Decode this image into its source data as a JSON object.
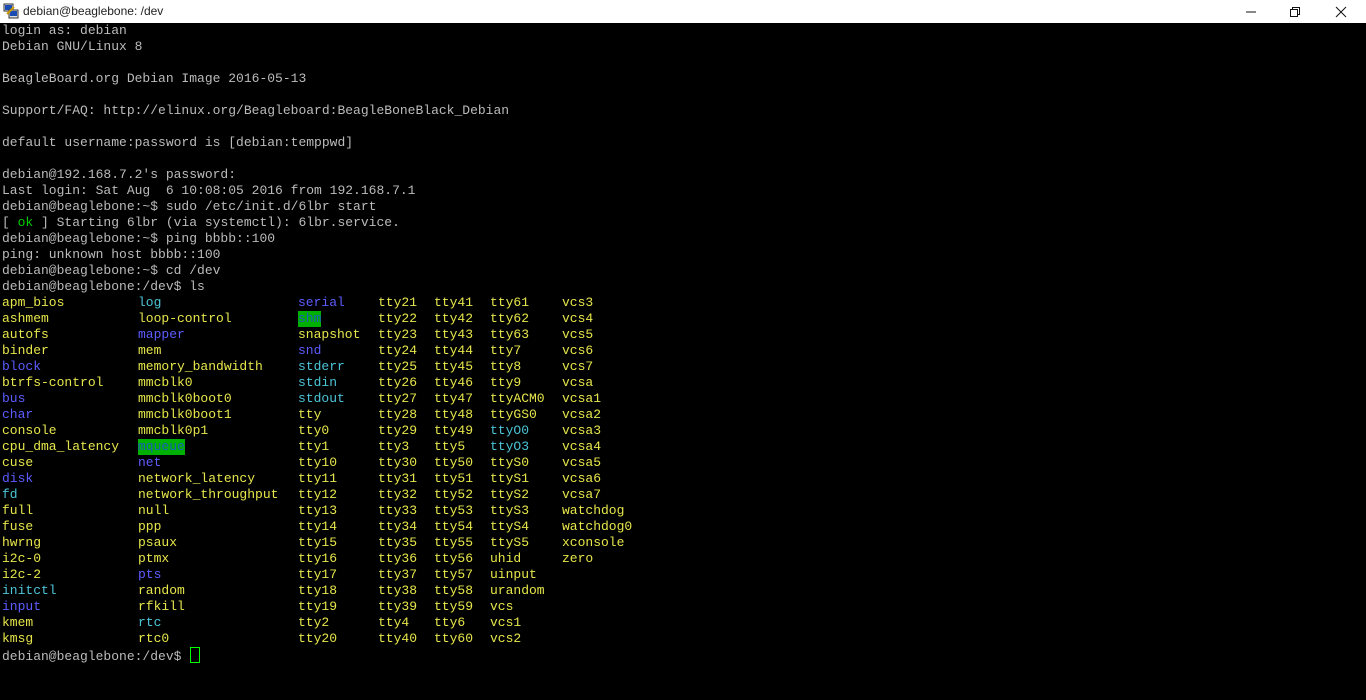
{
  "window": {
    "title": "debian@beaglebone: /dev",
    "app_icon": "putty-icon",
    "controls": [
      "minimize-icon",
      "maximize-icon",
      "close-icon"
    ]
  },
  "colors": {
    "background": "#000000",
    "text": "#bbbbbb",
    "file": "#e6e64c",
    "directory": "#5c5cff",
    "link": "#4cc4d8",
    "ok": "#00cd00",
    "highlight_bg": "#00b000"
  },
  "terminal": {
    "lines": [
      [
        {
          "t": "login as: debian"
        }
      ],
      [
        {
          "t": "Debian GNU/Linux 8"
        }
      ],
      [],
      [
        {
          "t": "BeagleBoard.org Debian Image 2016-05-13"
        }
      ],
      [],
      [
        {
          "t": "Support/FAQ: http://elinux.org/Beagleboard:BeagleBoneBlack_Debian"
        }
      ],
      [],
      [
        {
          "t": "default username:password is [debian:temppwd]"
        }
      ],
      [],
      [
        {
          "t": "debian@192.168.7.2's password:"
        }
      ],
      [
        {
          "t": "Last login: Sat Aug  6 10:08:05 2016 from 192.168.7.1"
        }
      ],
      [
        {
          "t": "debian@beaglebone:~$ sudo /etc/init.d/6lbr start"
        }
      ],
      [
        {
          "t": "[ "
        },
        {
          "t": "ok",
          "c": "green"
        },
        {
          "t": " ] Starting 6lbr (via systemctl): 6lbr.service."
        }
      ],
      [
        {
          "t": "debian@beaglebone:~$ ping bbbb::100"
        }
      ],
      [
        {
          "t": "ping: unknown host bbbb::100"
        }
      ],
      [
        {
          "t": "debian@beaglebone:~$ cd /dev"
        }
      ],
      [
        {
          "t": "debian@beaglebone:/dev$ ls"
        }
      ]
    ],
    "ls_grid": [
      [
        {
          "t": "apm_bios",
          "c": "yellow"
        },
        {
          "t": "log",
          "c": "cyan"
        },
        {
          "t": "serial",
          "c": "blue"
        },
        {
          "t": "tty21",
          "c": "yellow"
        },
        {
          "t": "tty41",
          "c": "yellow"
        },
        {
          "t": "tty61",
          "c": "yellow"
        },
        {
          "t": "vcs3",
          "c": "yellow"
        }
      ],
      [
        {
          "t": "ashmem",
          "c": "yellow"
        },
        {
          "t": "loop-control",
          "c": "yellow"
        },
        {
          "t": "shm",
          "c": "hl"
        },
        {
          "t": "tty22",
          "c": "yellow"
        },
        {
          "t": "tty42",
          "c": "yellow"
        },
        {
          "t": "tty62",
          "c": "yellow"
        },
        {
          "t": "vcs4",
          "c": "yellow"
        }
      ],
      [
        {
          "t": "autofs",
          "c": "yellow"
        },
        {
          "t": "mapper",
          "c": "blue"
        },
        {
          "t": "snapshot",
          "c": "yellow"
        },
        {
          "t": "tty23",
          "c": "yellow"
        },
        {
          "t": "tty43",
          "c": "yellow"
        },
        {
          "t": "tty63",
          "c": "yellow"
        },
        {
          "t": "vcs5",
          "c": "yellow"
        }
      ],
      [
        {
          "t": "binder",
          "c": "yellow"
        },
        {
          "t": "mem",
          "c": "yellow"
        },
        {
          "t": "snd",
          "c": "blue"
        },
        {
          "t": "tty24",
          "c": "yellow"
        },
        {
          "t": "tty44",
          "c": "yellow"
        },
        {
          "t": "tty7",
          "c": "yellow"
        },
        {
          "t": "vcs6",
          "c": "yellow"
        }
      ],
      [
        {
          "t": "block",
          "c": "blue"
        },
        {
          "t": "memory_bandwidth",
          "c": "yellow"
        },
        {
          "t": "stderr",
          "c": "cyan"
        },
        {
          "t": "tty25",
          "c": "yellow"
        },
        {
          "t": "tty45",
          "c": "yellow"
        },
        {
          "t": "tty8",
          "c": "yellow"
        },
        {
          "t": "vcs7",
          "c": "yellow"
        }
      ],
      [
        {
          "t": "btrfs-control",
          "c": "yellow"
        },
        {
          "t": "mmcblk0",
          "c": "yellow"
        },
        {
          "t": "stdin",
          "c": "cyan"
        },
        {
          "t": "tty26",
          "c": "yellow"
        },
        {
          "t": "tty46",
          "c": "yellow"
        },
        {
          "t": "tty9",
          "c": "yellow"
        },
        {
          "t": "vcsa",
          "c": "yellow"
        }
      ],
      [
        {
          "t": "bus",
          "c": "blue"
        },
        {
          "t": "mmcblk0boot0",
          "c": "yellow"
        },
        {
          "t": "stdout",
          "c": "cyan"
        },
        {
          "t": "tty27",
          "c": "yellow"
        },
        {
          "t": "tty47",
          "c": "yellow"
        },
        {
          "t": "ttyACM0",
          "c": "yellow"
        },
        {
          "t": "vcsa1",
          "c": "yellow"
        }
      ],
      [
        {
          "t": "char",
          "c": "blue"
        },
        {
          "t": "mmcblk0boot1",
          "c": "yellow"
        },
        {
          "t": "tty",
          "c": "yellow"
        },
        {
          "t": "tty28",
          "c": "yellow"
        },
        {
          "t": "tty48",
          "c": "yellow"
        },
        {
          "t": "ttyGS0",
          "c": "yellow"
        },
        {
          "t": "vcsa2",
          "c": "yellow"
        }
      ],
      [
        {
          "t": "console",
          "c": "yellow"
        },
        {
          "t": "mmcblk0p1",
          "c": "yellow"
        },
        {
          "t": "tty0",
          "c": "yellow"
        },
        {
          "t": "tty29",
          "c": "yellow"
        },
        {
          "t": "tty49",
          "c": "yellow"
        },
        {
          "t": "ttyO0",
          "c": "cyan"
        },
        {
          "t": "vcsa3",
          "c": "yellow"
        }
      ],
      [
        {
          "t": "cpu_dma_latency",
          "c": "yellow"
        },
        {
          "t": "mqueue",
          "c": "hl"
        },
        {
          "t": "tty1",
          "c": "yellow"
        },
        {
          "t": "tty3",
          "c": "yellow"
        },
        {
          "t": "tty5",
          "c": "yellow"
        },
        {
          "t": "ttyO3",
          "c": "cyan"
        },
        {
          "t": "vcsa4",
          "c": "yellow"
        }
      ],
      [
        {
          "t": "cuse",
          "c": "yellow"
        },
        {
          "t": "net",
          "c": "blue"
        },
        {
          "t": "tty10",
          "c": "yellow"
        },
        {
          "t": "tty30",
          "c": "yellow"
        },
        {
          "t": "tty50",
          "c": "yellow"
        },
        {
          "t": "ttyS0",
          "c": "yellow"
        },
        {
          "t": "vcsa5",
          "c": "yellow"
        }
      ],
      [
        {
          "t": "disk",
          "c": "blue"
        },
        {
          "t": "network_latency",
          "c": "yellow"
        },
        {
          "t": "tty11",
          "c": "yellow"
        },
        {
          "t": "tty31",
          "c": "yellow"
        },
        {
          "t": "tty51",
          "c": "yellow"
        },
        {
          "t": "ttyS1",
          "c": "yellow"
        },
        {
          "t": "vcsa6",
          "c": "yellow"
        }
      ],
      [
        {
          "t": "fd",
          "c": "cyan"
        },
        {
          "t": "network_throughput",
          "c": "yellow"
        },
        {
          "t": "tty12",
          "c": "yellow"
        },
        {
          "t": "tty32",
          "c": "yellow"
        },
        {
          "t": "tty52",
          "c": "yellow"
        },
        {
          "t": "ttyS2",
          "c": "yellow"
        },
        {
          "t": "vcsa7",
          "c": "yellow"
        }
      ],
      [
        {
          "t": "full",
          "c": "yellow"
        },
        {
          "t": "null",
          "c": "yellow"
        },
        {
          "t": "tty13",
          "c": "yellow"
        },
        {
          "t": "tty33",
          "c": "yellow"
        },
        {
          "t": "tty53",
          "c": "yellow"
        },
        {
          "t": "ttyS3",
          "c": "yellow"
        },
        {
          "t": "watchdog",
          "c": "yellow"
        }
      ],
      [
        {
          "t": "fuse",
          "c": "yellow"
        },
        {
          "t": "ppp",
          "c": "yellow"
        },
        {
          "t": "tty14",
          "c": "yellow"
        },
        {
          "t": "tty34",
          "c": "yellow"
        },
        {
          "t": "tty54",
          "c": "yellow"
        },
        {
          "t": "ttyS4",
          "c": "yellow"
        },
        {
          "t": "watchdog0",
          "c": "yellow"
        }
      ],
      [
        {
          "t": "hwrng",
          "c": "yellow"
        },
        {
          "t": "psaux",
          "c": "yellow"
        },
        {
          "t": "tty15",
          "c": "yellow"
        },
        {
          "t": "tty35",
          "c": "yellow"
        },
        {
          "t": "tty55",
          "c": "yellow"
        },
        {
          "t": "ttyS5",
          "c": "yellow"
        },
        {
          "t": "xconsole",
          "c": "yellow"
        }
      ],
      [
        {
          "t": "i2c-0",
          "c": "yellow"
        },
        {
          "t": "ptmx",
          "c": "yellow"
        },
        {
          "t": "tty16",
          "c": "yellow"
        },
        {
          "t": "tty36",
          "c": "yellow"
        },
        {
          "t": "tty56",
          "c": "yellow"
        },
        {
          "t": "uhid",
          "c": "yellow"
        },
        {
          "t": "zero",
          "c": "yellow"
        }
      ],
      [
        {
          "t": "i2c-2",
          "c": "yellow"
        },
        {
          "t": "pts",
          "c": "blue"
        },
        {
          "t": "tty17",
          "c": "yellow"
        },
        {
          "t": "tty37",
          "c": "yellow"
        },
        {
          "t": "tty57",
          "c": "yellow"
        },
        {
          "t": "uinput",
          "c": "yellow"
        }
      ],
      [
        {
          "t": "initctl",
          "c": "cyan"
        },
        {
          "t": "random",
          "c": "yellow"
        },
        {
          "t": "tty18",
          "c": "yellow"
        },
        {
          "t": "tty38",
          "c": "yellow"
        },
        {
          "t": "tty58",
          "c": "yellow"
        },
        {
          "t": "urandom",
          "c": "yellow"
        }
      ],
      [
        {
          "t": "input",
          "c": "blue"
        },
        {
          "t": "rfkill",
          "c": "yellow"
        },
        {
          "t": "tty19",
          "c": "yellow"
        },
        {
          "t": "tty39",
          "c": "yellow"
        },
        {
          "t": "tty59",
          "c": "yellow"
        },
        {
          "t": "vcs",
          "c": "yellow"
        }
      ],
      [
        {
          "t": "kmem",
          "c": "yellow"
        },
        {
          "t": "rtc",
          "c": "cyan"
        },
        {
          "t": "tty2",
          "c": "yellow"
        },
        {
          "t": "tty4",
          "c": "yellow"
        },
        {
          "t": "tty6",
          "c": "yellow"
        },
        {
          "t": "vcs1",
          "c": "yellow"
        }
      ],
      [
        {
          "t": "kmsg",
          "c": "yellow"
        },
        {
          "t": "rtc0",
          "c": "yellow"
        },
        {
          "t": "tty20",
          "c": "yellow"
        },
        {
          "t": "tty40",
          "c": "yellow"
        },
        {
          "t": "tty60",
          "c": "yellow"
        },
        {
          "t": "vcs2",
          "c": "yellow"
        }
      ]
    ],
    "prompt": "debian@beaglebone:/dev$ "
  }
}
